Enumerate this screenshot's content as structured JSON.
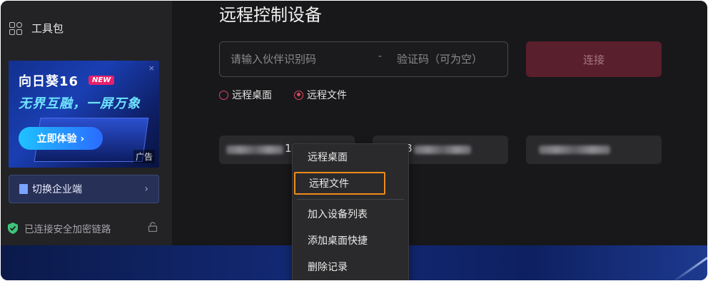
{
  "sidebar": {
    "toolkit_label": "工具包",
    "ad": {
      "title": "向日葵16",
      "badge": "NEW",
      "slogan": "无界互融，一屏万象",
      "button_label": "立即体验 ›",
      "tag": "广告",
      "close": "×"
    },
    "switch_label": "切换企业端",
    "switch_chevron": "›",
    "security_text": "已连接安全加密链路"
  },
  "main": {
    "title": "远程控制设备",
    "id_placeholder": "请输入伙伴识别码",
    "separator": "-",
    "code_placeholder": "验证码（可为空）",
    "connect_label": "连接",
    "radios": [
      {
        "label": "远程桌面",
        "selected": false
      },
      {
        "label": "远程文件",
        "selected": true
      }
    ],
    "devices": [
      {
        "visible_digit": "1"
      },
      {
        "visible_digit": "8"
      },
      {
        "visible_digit": ""
      }
    ]
  },
  "context_menu": {
    "items": [
      {
        "label": "远程桌面",
        "highlighted": false
      },
      {
        "label": "远程文件",
        "highlighted": true
      },
      {
        "label": "加入设备列表",
        "highlighted": false
      },
      {
        "label": "添加桌面快捷",
        "highlighted": false
      },
      {
        "label": "删除记录",
        "highlighted": false
      }
    ]
  },
  "colors": {
    "accent": "#d84a62",
    "highlight_border": "#f08a1c",
    "connect_bg": "#5a1f2c",
    "security_ok": "#3ec37a"
  }
}
